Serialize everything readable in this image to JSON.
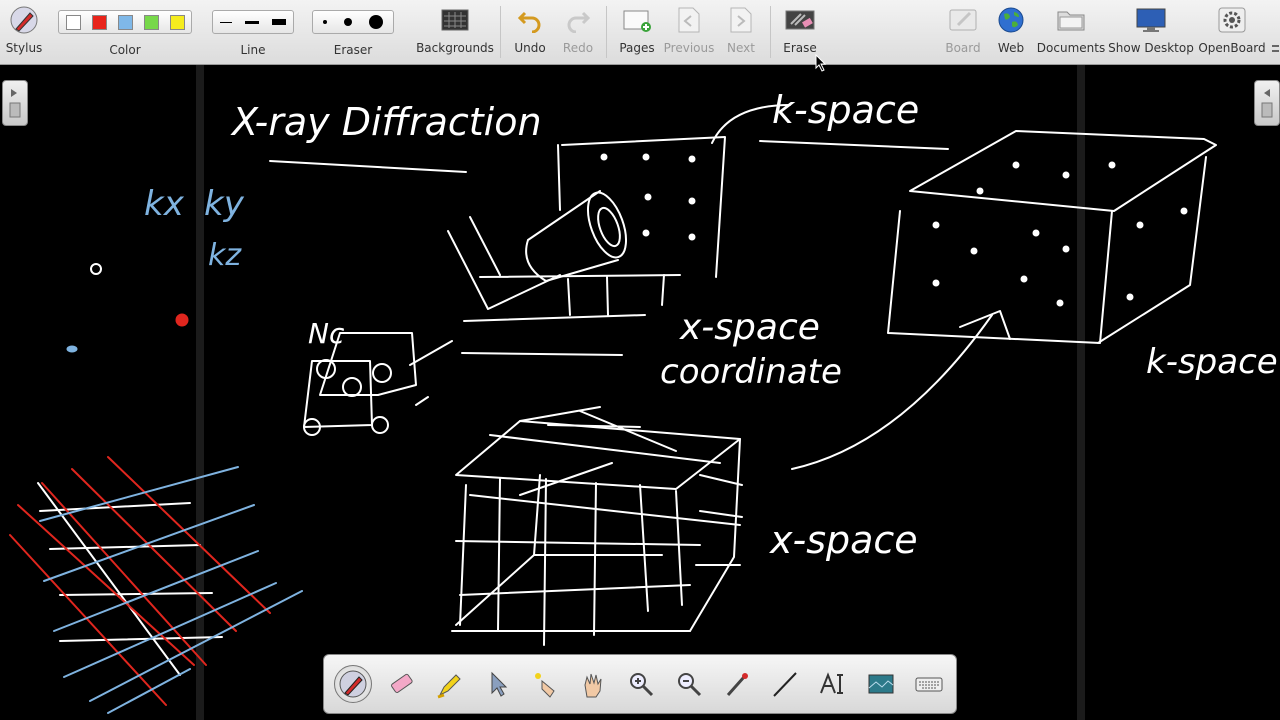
{
  "toolbar": {
    "stylus": "Stylus",
    "color": "Color",
    "line": "Line",
    "eraser": "Eraser",
    "backgrounds": "Backgrounds",
    "undo": "Undo",
    "redo": "Redo",
    "pages": "Pages",
    "previous": "Previous",
    "next": "Next",
    "erase": "Erase",
    "board": "Board",
    "web": "Web",
    "documents": "Documents",
    "show_desktop": "Show Desktop",
    "openboard": "OpenBoard"
  },
  "colors": {
    "swatches": [
      "#ffffff",
      "#e8241b",
      "#7fb8e8",
      "#77d84a",
      "#f5ec1e"
    ],
    "ink_white": "#ffffff",
    "ink_red": "#e0261e",
    "ink_blue": "#7fb3e0"
  },
  "handwriting": {
    "title": "X-ray Diffraction",
    "k_space_top": "k-space",
    "x_space_coordinate_1": "x-space",
    "x_space_coordinate_2": "coordinate",
    "k_space_right": "k-space",
    "x_space_bottom": "x-space",
    "kx": "kx",
    "ky": "ky",
    "kz": "kz",
    "nc": "Nc"
  },
  "palette_tools": [
    "pen-icon",
    "eraser-icon",
    "highlighter-icon",
    "pointer-icon",
    "laser-icon",
    "hand-icon",
    "zoom-in-icon",
    "zoom-out-icon",
    "pick-color-icon",
    "line-icon",
    "text-icon",
    "capture-icon",
    "keyboard-icon"
  ]
}
